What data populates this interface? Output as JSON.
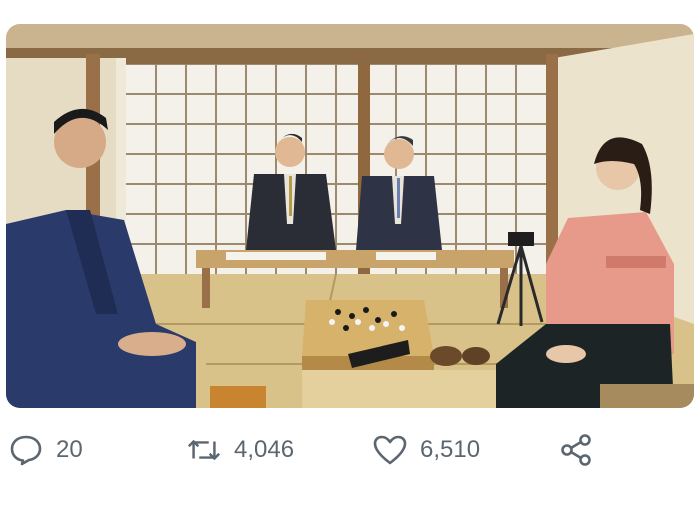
{
  "tweet": {
    "media": {
      "alt_subject": "photo"
    },
    "actions": {
      "reply": {
        "icon": "speech-bubble-icon",
        "count": "20"
      },
      "retweet": {
        "icon": "retweet-icon",
        "count": "4,046"
      },
      "like": {
        "icon": "heart-icon",
        "count": "6,510"
      },
      "share": {
        "icon": "share-icon"
      }
    }
  },
  "colors": {
    "action_text": "#5b6670",
    "background": "#ffffff",
    "tatami": "#d8c28a",
    "wall": "#eee8d8",
    "wood": "#9a7048"
  }
}
